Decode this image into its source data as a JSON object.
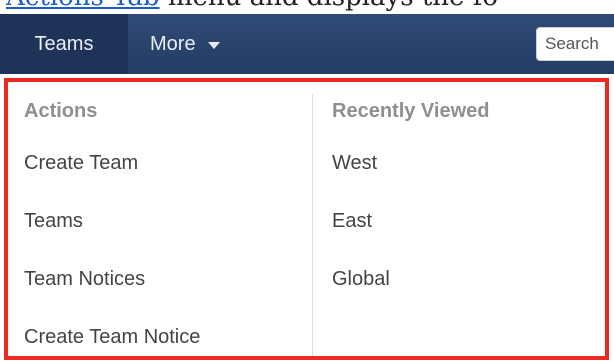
{
  "doc": {
    "link_text": "Actions Tab",
    "trailing_text": "menu and displays the fo"
  },
  "nav": {
    "teams_label": "Teams",
    "more_label": "More",
    "search_placeholder": "Search"
  },
  "dropdown": {
    "actions": {
      "header": "Actions",
      "items": [
        "Create Team",
        "Teams",
        "Team Notices",
        "Create Team Notice"
      ]
    },
    "recent": {
      "header": "Recently Viewed",
      "items": [
        "West",
        "East",
        "Global"
      ]
    }
  },
  "colors": {
    "navbar": "#2b4470",
    "active_tab": "#1f3358",
    "highlight_border": "#ec2a1f",
    "header_text": "#8f8f8f",
    "item_text": "#444444"
  },
  "icons": {
    "more_caret": "chevron-down-icon"
  }
}
